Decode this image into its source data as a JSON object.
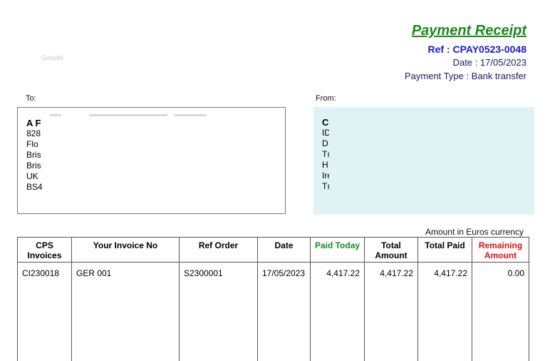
{
  "header": {
    "logo_text": "Gobelin",
    "title": "Payment Receipt",
    "ref": "Ref : CPAY0523-0048",
    "date": "Date : 17/05/2023",
    "payment_type": "Payment Type : Bank transfer"
  },
  "to": {
    "label": "To:",
    "lines": [
      "A F",
      "828",
      "Flo ",
      "Bris",
      "Bris",
      "UK",
      "BS4"
    ]
  },
  "from": {
    "label": "From:",
    "lines": [
      "C",
      "ID",
      "D",
      "Tı",
      "H",
      "Ire",
      "Tı"
    ]
  },
  "currency_note": "Amount in Euros currency",
  "table": {
    "headers": [
      "CPS Invoices",
      "Your Invoice No",
      "Ref Order",
      "Date",
      "Paid Today",
      "Total Amount",
      "Total Paid",
      "Remaining Amount"
    ],
    "rows": [
      [
        "CI230018",
        "GER 001",
        "S2300001",
        "17/05/2023",
        "4,417.22",
        "4,417.22",
        "4,417.22",
        "0.00"
      ]
    ]
  },
  "colors": {
    "title_green": "#1a8a1a",
    "ref_blue": "#1a1acc",
    "remaining_red": "#dd1111",
    "from_box_bg": "#dff3f4"
  }
}
